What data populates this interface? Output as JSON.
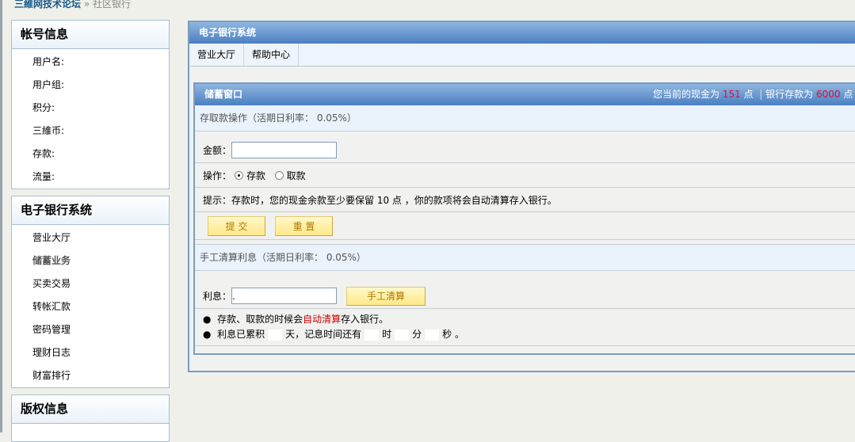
{
  "breadcrumb": {
    "site": "三維网技术论坛",
    "sep": "»",
    "current": "社区银行"
  },
  "account": {
    "title": "帐号信息",
    "items": [
      "用户名:",
      "用户组:",
      "积分:",
      "三維币:",
      "存款:",
      "流量:"
    ]
  },
  "bank_nav": {
    "title": "电子银行系统",
    "items": [
      "营业大厅",
      "储蓄业务",
      "买卖交易",
      "转帐汇款",
      "密码管理",
      "理财日志",
      "财富排行"
    ],
    "active": 1
  },
  "copyright": {
    "title": "版权信息"
  },
  "main": {
    "title": "电子银行系统",
    "tabs": [
      "营业大厅",
      "帮助中心"
    ]
  },
  "savings": {
    "title": "储蓄窗口",
    "cash_label": "您当前的现金为",
    "cash": "151",
    "unit": "点",
    "deposit_label": "银行存款为",
    "deposit": "6000",
    "unit2": "点",
    "section1": "存取款操作（活期日利率： 0.05%）",
    "amount_label": "金额：",
    "amount_value": "",
    "op_label": "操作：",
    "op_deposit": "存款",
    "op_withdraw": "取款",
    "tip": "提示：存款时，您的现金余款至少要保留 10 点 ，你的款项将会自动清算存入银行。",
    "submit": "提 交",
    "reset": "重 置",
    "section2": "手工清算利息（活期日利率： 0.05%）",
    "interest_label": "利息：",
    "interest_value": ".",
    "settle": "手工清算",
    "note1_a": "存款、取款的时候会",
    "note1_link": "自动清算",
    "note1_b": "存入银行。",
    "note2_a": "利息已累积",
    "note2_day": "天，记息时间还有",
    "note2_h": "时",
    "note2_m": "分",
    "note2_s": "秒 。"
  }
}
